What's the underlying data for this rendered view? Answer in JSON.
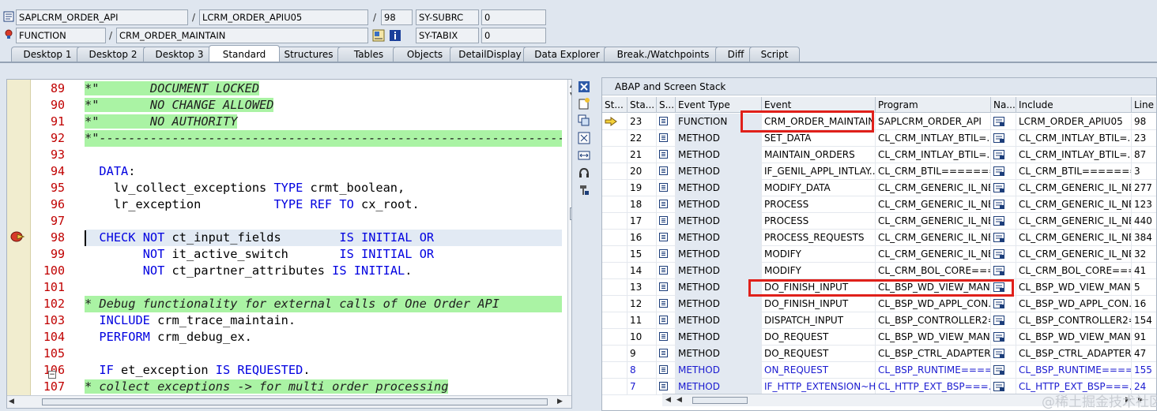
{
  "header": {
    "row1": {
      "program": "SAPLCRM_ORDER_API",
      "separator": "/",
      "include": "LCRM_ORDER_APIU05",
      "separator2": "/",
      "line": "98",
      "var_name": "SY-SUBRC",
      "var_value": "0"
    },
    "row2": {
      "type": "FUNCTION",
      "separator": "/",
      "name": "CRM_ORDER_MAINTAIN",
      "var_name": "SY-TABIX",
      "var_value": "0"
    }
  },
  "tabs": [
    {
      "label": "Desktop 1",
      "active": false
    },
    {
      "label": "Desktop 2",
      "active": false
    },
    {
      "label": "Desktop 3",
      "active": false
    },
    {
      "label": "Standard",
      "active": true
    },
    {
      "label": "Structures",
      "active": false
    },
    {
      "label": "Tables",
      "active": false
    },
    {
      "label": "Objects",
      "active": false
    },
    {
      "label": "DetailDisplay",
      "active": false
    },
    {
      "label": "Data Explorer",
      "active": false
    },
    {
      "label": "Break./Watchpoints",
      "active": false
    },
    {
      "label": "Diff",
      "active": false
    },
    {
      "label": "Script",
      "active": false
    }
  ],
  "editor": {
    "lines": [
      {
        "no": "89",
        "text": "*\"       DOCUMENT LOCKED",
        "kind": "comment"
      },
      {
        "no": "90",
        "text": "*\"       NO CHANGE ALLOWED",
        "kind": "comment"
      },
      {
        "no": "91",
        "text": "*\"       NO AUTHORITY",
        "kind": "comment"
      },
      {
        "no": "92",
        "text": "*\"----------------------------------------------------------------------",
        "kind": "comment-full"
      },
      {
        "no": "93",
        "text": "",
        "kind": "code"
      },
      {
        "no": "94",
        "text": "  DATA:",
        "kind": "code"
      },
      {
        "no": "95",
        "text": "    lv_collect_exceptions TYPE crmt_boolean,",
        "kind": "code"
      },
      {
        "no": "96",
        "text": "    lr_exception          TYPE REF TO cx_root.",
        "kind": "code"
      },
      {
        "no": "97",
        "text": "",
        "kind": "code"
      },
      {
        "no": "98",
        "text": "  CHECK NOT ct_input_fields        IS INITIAL OR",
        "kind": "current"
      },
      {
        "no": "99",
        "text": "        NOT it_active_switch       IS INITIAL OR",
        "kind": "code"
      },
      {
        "no": "100",
        "text": "        NOT ct_partner_attributes IS INITIAL.",
        "kind": "code"
      },
      {
        "no": "101",
        "text": "",
        "kind": "code"
      },
      {
        "no": "102",
        "text": "* Debug functionality for external calls of One Order API",
        "kind": "comment-full"
      },
      {
        "no": "103",
        "text": "  INCLUDE crm_trace_maintain.",
        "kind": "code"
      },
      {
        "no": "104",
        "text": "  PERFORM crm_debug_ex.",
        "kind": "code"
      },
      {
        "no": "105",
        "text": "",
        "kind": "code"
      },
      {
        "no": "106",
        "text": "  IF et_exception IS REQUESTED.",
        "kind": "code"
      },
      {
        "no": "107",
        "text": "* collect exceptions -> for multi order processing",
        "kind": "comment"
      }
    ]
  },
  "stack": {
    "title": "ABAP and Screen Stack",
    "columns": [
      "St...",
      "Sta...",
      "S...",
      "Event Type",
      "Event",
      "Program",
      "Na...",
      "Include",
      "Line"
    ],
    "rows": [
      {
        "level": "23",
        "type": "FUNCTION",
        "event": "CRM_ORDER_MAINTAIN",
        "program": "SAPLCRM_ORDER_API",
        "include": "LCRM_ORDER_APIU05",
        "line": "98",
        "current": true,
        "blue": false
      },
      {
        "level": "22",
        "type": "METHOD",
        "event": "SET_DATA",
        "program": "CL_CRM_INTLAY_BTIL=...",
        "include": "CL_CRM_INTLAY_BTIL=...",
        "line": "23",
        "current": false,
        "blue": false
      },
      {
        "level": "21",
        "type": "METHOD",
        "event": "MAINTAIN_ORDERS",
        "program": "CL_CRM_INTLAY_BTIL=...",
        "include": "CL_CRM_INTLAY_BTIL=...",
        "line": "87",
        "current": false,
        "blue": false
      },
      {
        "level": "20",
        "type": "METHOD",
        "event": "IF_GENIL_APPL_INTLAY...",
        "program": "CL_CRM_BTIL========...",
        "include": "CL_CRM_BTIL========...",
        "line": "3",
        "current": false,
        "blue": false
      },
      {
        "level": "19",
        "type": "METHOD",
        "event": "MODIFY_DATA",
        "program": "CL_CRM_GENERIC_IL_NE...",
        "include": "CL_CRM_GENERIC_IL_NE...",
        "line": "277",
        "current": false,
        "blue": false
      },
      {
        "level": "18",
        "type": "METHOD",
        "event": "PROCESS",
        "program": "CL_CRM_GENERIC_IL_NE...",
        "include": "CL_CRM_GENERIC_IL_NE...",
        "line": "123",
        "current": false,
        "blue": false
      },
      {
        "level": "17",
        "type": "METHOD",
        "event": "PROCESS",
        "program": "CL_CRM_GENERIC_IL_NE...",
        "include": "CL_CRM_GENERIC_IL_NE...",
        "line": "440",
        "current": false,
        "blue": false
      },
      {
        "level": "16",
        "type": "METHOD",
        "event": "PROCESS_REQUESTS",
        "program": "CL_CRM_GENERIC_IL_NE...",
        "include": "CL_CRM_GENERIC_IL_NE...",
        "line": "384",
        "current": false,
        "blue": false
      },
      {
        "level": "15",
        "type": "METHOD",
        "event": "MODIFY",
        "program": "CL_CRM_GENERIC_IL_NE...",
        "include": "CL_CRM_GENERIC_IL_NE...",
        "line": "32",
        "current": false,
        "blue": false
      },
      {
        "level": "14",
        "type": "METHOD",
        "event": "MODIFY",
        "program": "CL_CRM_BOL_CORE====...",
        "include": "CL_CRM_BOL_CORE====...",
        "line": "41",
        "current": false,
        "blue": false
      },
      {
        "level": "13",
        "type": "METHOD",
        "event": "DO_FINISH_INPUT",
        "program": "CL_BSP_WD_VIEW_MAN...",
        "include": "CL_BSP_WD_VIEW_MAN...",
        "line": "5",
        "current": false,
        "blue": false
      },
      {
        "level": "12",
        "type": "METHOD",
        "event": "DO_FINISH_INPUT",
        "program": "CL_BSP_WD_APPL_CON...",
        "include": "CL_BSP_WD_APPL_CON...",
        "line": "16",
        "current": false,
        "blue": false
      },
      {
        "level": "11",
        "type": "METHOD",
        "event": "DISPATCH_INPUT",
        "program": "CL_BSP_CONTROLLER2=...",
        "include": "CL_BSP_CONTROLLER2=...",
        "line": "154",
        "current": false,
        "blue": false
      },
      {
        "level": "10",
        "type": "METHOD",
        "event": "DO_REQUEST",
        "program": "CL_BSP_WD_VIEW_MAN...",
        "include": "CL_BSP_WD_VIEW_MAN...",
        "line": "91",
        "current": false,
        "blue": false
      },
      {
        "level": "9",
        "type": "METHOD",
        "event": "DO_REQUEST",
        "program": "CL_BSP_CTRL_ADAPTER...",
        "include": "CL_BSP_CTRL_ADAPTER...",
        "line": "47",
        "current": false,
        "blue": false
      },
      {
        "level": "8",
        "type": "METHOD",
        "event": "ON_REQUEST",
        "program": "CL_BSP_RUNTIME====...",
        "include": "CL_BSP_RUNTIME====...",
        "line": "155",
        "current": false,
        "blue": true
      },
      {
        "level": "7",
        "type": "METHOD",
        "event": "IF_HTTP_EXTENSION~H...",
        "program": "CL_HTTP_EXT_BSP===...",
        "include": "CL_HTTP_EXT_BSP===...",
        "line": "24",
        "current": false,
        "blue": true
      }
    ]
  },
  "watermark": "@稀土掘金技术社区",
  "colors": {
    "comment_bg": "#aaf3a4",
    "keyword": "#0000e0",
    "line_number": "#c00000",
    "highlight_box": "#e0201a",
    "link_blue": "#1a1ad0"
  },
  "icons": [
    "program-icon",
    "function-icon",
    "display-icon",
    "info-icon",
    "breakpoint-icon",
    "current-line-arrow-icon",
    "table-icon",
    "navigate-icon",
    "close-icon",
    "new-icon",
    "copy-icon",
    "fullscreen-icon",
    "resize-icon",
    "settings-icon",
    "scroll-up-icon",
    "scroll-down-icon"
  ]
}
